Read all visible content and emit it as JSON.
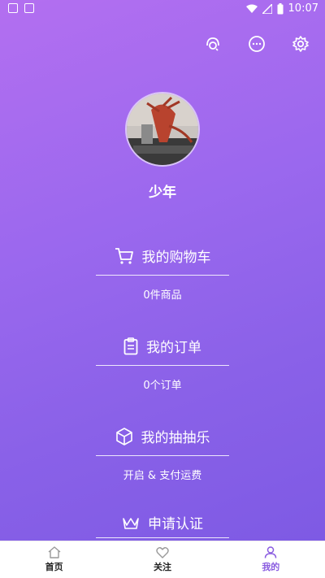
{
  "status_bar": {
    "time": "10:07"
  },
  "profile": {
    "username": "少年"
  },
  "sections": [
    {
      "title": "我的购物车",
      "subtitle": "0件商品",
      "icon": "cart-icon"
    },
    {
      "title": "我的订单",
      "subtitle": "0个订单",
      "icon": "clipboard-icon"
    },
    {
      "title": "我的抽抽乐",
      "subtitle": "开启 & 支付运费",
      "icon": "box-icon"
    },
    {
      "title": "申请认证",
      "icon": "crown-icon"
    }
  ],
  "bottom_nav": [
    {
      "label": "首页",
      "icon": "home-icon"
    },
    {
      "label": "关注",
      "icon": "heart-icon"
    },
    {
      "label": "我的",
      "icon": "person-icon",
      "active": true
    }
  ],
  "colors": {
    "gradient_top": "#b36ff0",
    "gradient_bottom": "#7e5ae4",
    "active_nav": "#8a5ce0"
  }
}
